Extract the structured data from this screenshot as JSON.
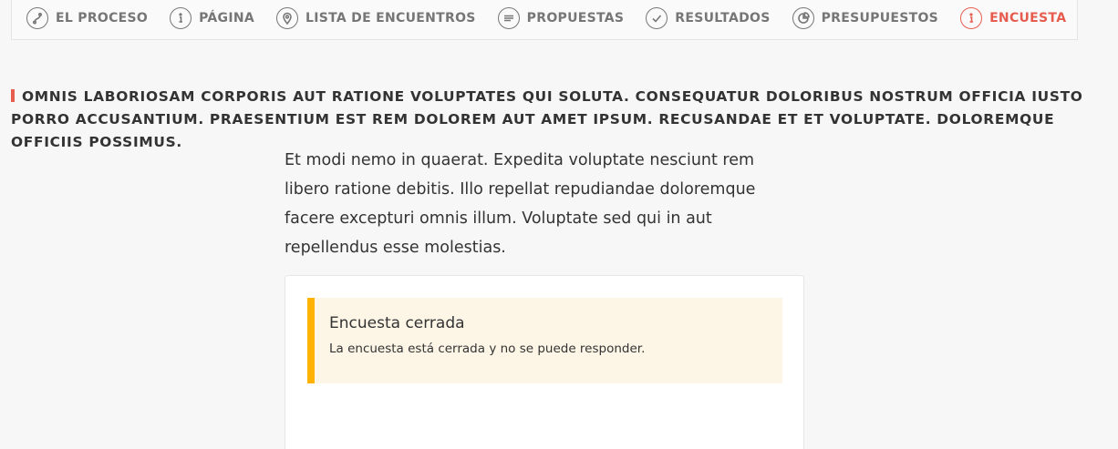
{
  "nav": {
    "items": [
      {
        "label": "EL PROCESO",
        "icon": "process-icon"
      },
      {
        "label": "PÁGINA",
        "icon": "info-icon"
      },
      {
        "label": "LISTA DE ENCUENTROS",
        "icon": "map-pin-icon"
      },
      {
        "label": "PROPUESTAS",
        "icon": "lines-icon"
      },
      {
        "label": "RESULTADOS",
        "icon": "check-icon"
      },
      {
        "label": "PRESUPUESTOS",
        "icon": "pie-icon"
      },
      {
        "label": "ENCUESTA",
        "icon": "info-icon",
        "active": true
      }
    ],
    "active_color": "#e65d4f"
  },
  "title": "Omnis laboriosam corporis aut ratione voluptates qui soluta. Consequatur doloribus nostrum officia iusto porro accusantium. Praesentium est rem dolorem aut amet ipsum. Recusandae et et voluptate. Doloremque officiis possimus.",
  "description": "Et modi nemo in quaerat. Expedita voluptate nesciunt rem libero ratione debitis. Illo repellat repudiandae doloremque facere excepturi omnis illum. Voluptate sed qui in aut repellendus esse molestias.",
  "callout": {
    "title": "Encuesta cerrada",
    "text": "La encuesta está cerrada y no se puede responder.",
    "accent": "#ffb300"
  }
}
